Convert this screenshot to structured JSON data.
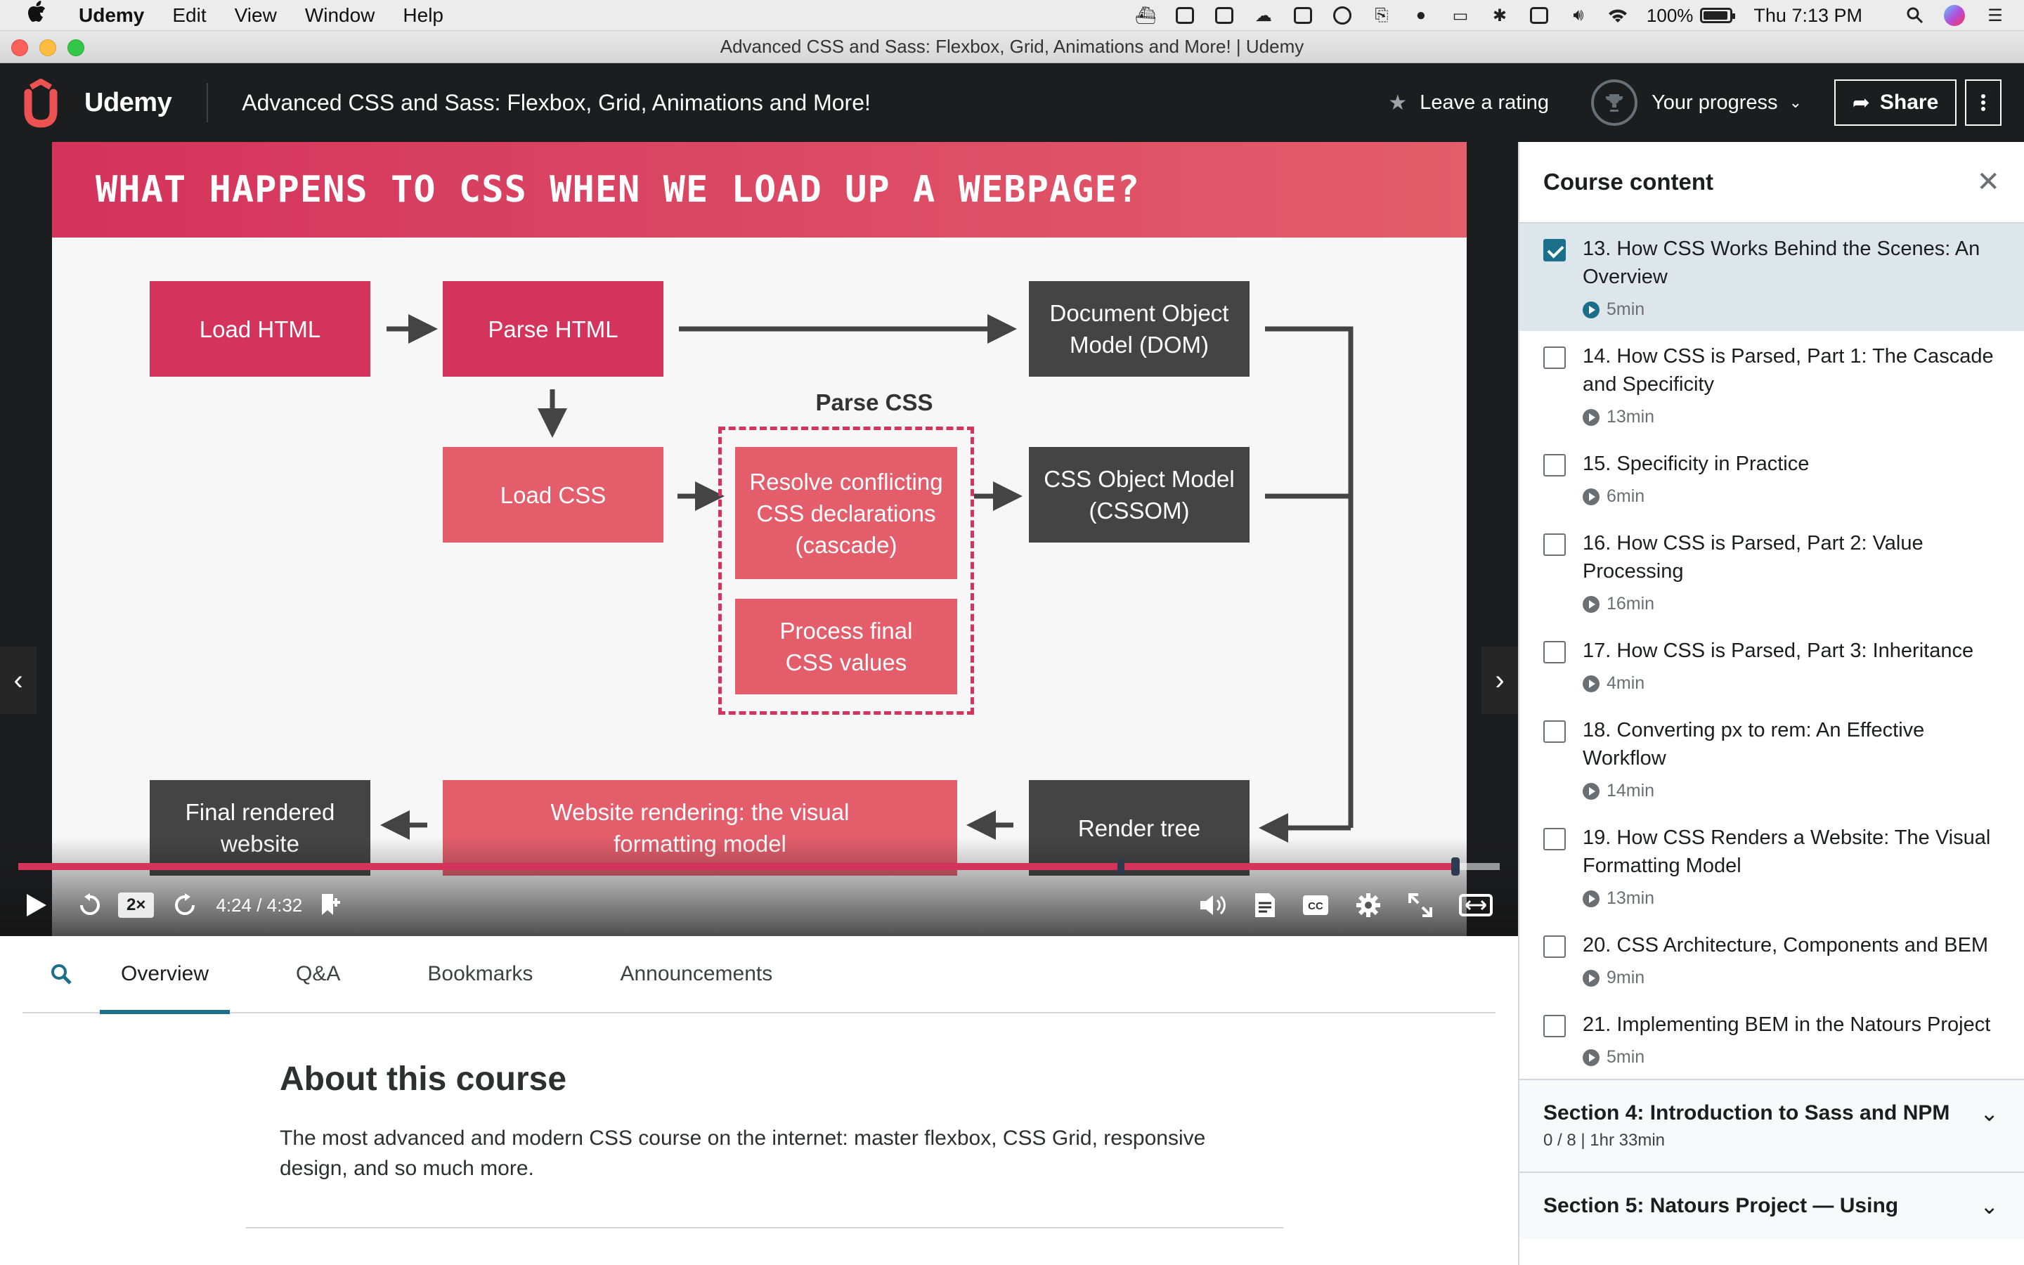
{
  "menubar": {
    "apple": "",
    "app_name": "Udemy",
    "items": [
      "Edit",
      "View",
      "Window",
      "Help"
    ],
    "battery": "100%",
    "clock": "Thu 7:13 PM"
  },
  "window": {
    "title": "Advanced CSS and Sass: Flexbox, Grid, Animations and More! | Udemy"
  },
  "header": {
    "logo_text": "Udemy",
    "course_title": "Advanced CSS and Sass: Flexbox, Grid, Animations and More!",
    "rating_label": "Leave a rating",
    "progress_label": "Your progress",
    "share_label": "Share"
  },
  "slide": {
    "heading": "WHAT HAPPENS TO CSS WHEN WE LOAD UP A WEBPAGE?",
    "boxes": {
      "load_html": "Load HTML",
      "parse_html": "Parse HTML",
      "dom": "Document Object Model (DOM)",
      "load_css": "Load CSS",
      "parse_css": "Parse CSS",
      "resolve": "Resolve conflicting CSS declarations (cascade)",
      "process": "Process final CSS values",
      "cssom": "CSS Object Model (CSSOM)",
      "final": "Final rendered website",
      "rendering": "Website rendering: the visual formatting model",
      "render_tree": "Render tree"
    }
  },
  "player": {
    "speed": "2×",
    "time": "4:24 / 4:32",
    "progress": 0.97
  },
  "tabs": [
    "Overview",
    "Q&A",
    "Bookmarks",
    "Announcements"
  ],
  "about": {
    "title": "About this course",
    "description": "The most advanced and modern CSS course on the internet: master flexbox, CSS Grid, responsive design, and so much more."
  },
  "sidebar": {
    "title": "Course content",
    "lectures": [
      {
        "title": "13. How CSS Works Behind the Scenes: An Overview",
        "duration": "5min",
        "checked": true
      },
      {
        "title": "14. How CSS is Parsed, Part 1: The Cascade and Specificity",
        "duration": "13min",
        "checked": false
      },
      {
        "title": "15. Specificity in Practice",
        "duration": "6min",
        "checked": false
      },
      {
        "title": "16. How CSS is Parsed, Part 2: Value Processing",
        "duration": "16min",
        "checked": false
      },
      {
        "title": "17. How CSS is Parsed, Part 3: Inheritance",
        "duration": "4min",
        "checked": false
      },
      {
        "title": "18. Converting px to rem: An Effective Workflow",
        "duration": "14min",
        "checked": false
      },
      {
        "title": "19. How CSS Renders a Website: The Visual Formatting Model",
        "duration": "13min",
        "checked": false
      },
      {
        "title": "20. CSS Architecture, Components and BEM",
        "duration": "9min",
        "checked": false
      },
      {
        "title": "21. Implementing BEM in the Natours Project",
        "duration": "5min",
        "checked": false
      }
    ],
    "sections": [
      {
        "title": "Section 4: Introduction to Sass and NPM",
        "meta": "0 / 8  |  1hr 33min"
      },
      {
        "title": "Section 5: Natours Project — Using",
        "meta": ""
      }
    ]
  }
}
